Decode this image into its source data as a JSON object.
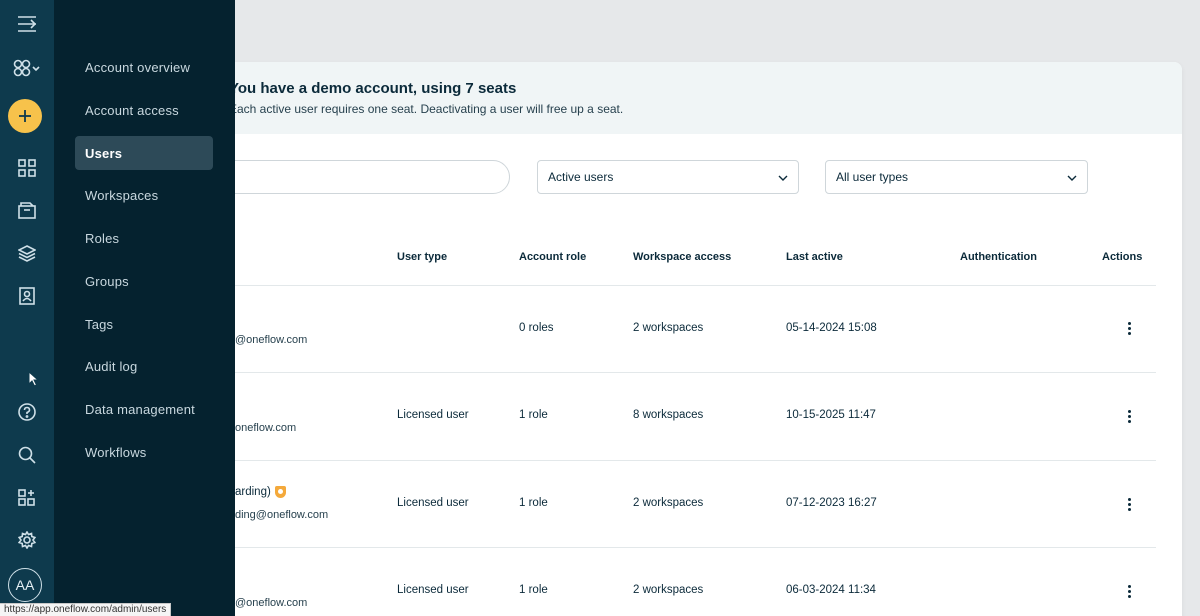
{
  "drawer": {
    "items": [
      {
        "label": "Account overview"
      },
      {
        "label": "Account access"
      },
      {
        "label": "Users"
      },
      {
        "label": "Workspaces"
      },
      {
        "label": "Roles"
      },
      {
        "label": "Groups"
      },
      {
        "label": "Tags"
      },
      {
        "label": "Audit log"
      },
      {
        "label": "Data management"
      },
      {
        "label": "Workflows"
      }
    ]
  },
  "rail": {
    "avatar_initials": "AA",
    "icons": [
      "menu-collapse-icon",
      "workspace-switcher-icon",
      "plus-icon",
      "dashboard-grid-icon",
      "documents-icon",
      "templates-layers-icon",
      "contacts-icon",
      "help-icon",
      "search-icon",
      "extensions-icon",
      "settings-icon"
    ]
  },
  "banner": {
    "title": "You have a demo account, using 7 seats",
    "subtitle": "Each active user requires one seat. Deactivating a user will free up a seat."
  },
  "filters": {
    "status_select": "Active users",
    "type_select": "All user types"
  },
  "table": {
    "headers": {
      "user_type": "User type",
      "account_role": "Account role",
      "workspace_access": "Workspace access",
      "last_active": "Last active",
      "authentication": "Authentication",
      "actions": "Actions"
    },
    "rows": [
      {
        "name": "",
        "email": "@oneflow.com",
        "user_type": "",
        "account_role": "0 roles",
        "workspace_access": "2 workspaces",
        "last_active": "05-14-2024 15:08"
      },
      {
        "name": "",
        "email": "oneflow.com",
        "user_type": "Licensed user",
        "account_role": "1 role",
        "workspace_access": "8 workspaces",
        "last_active": "10-15-2025 11:47"
      },
      {
        "name": "arding)",
        "email": "ding@oneflow.com",
        "user_type": "Licensed user",
        "account_role": "1 role",
        "workspace_access": "2 workspaces",
        "last_active": "07-12-2023 16:27"
      },
      {
        "name": "",
        "email": "@oneflow.com",
        "user_type": "Licensed user",
        "account_role": "1 role",
        "workspace_access": "2 workspaces",
        "last_active": "06-03-2024 11:34"
      }
    ]
  },
  "status_url": "https://app.oneflow.com/admin/users",
  "colors": {
    "rail_bg": "#0e3a4d",
    "drawer_bg": "#05222f",
    "accent_yellow": "#f7c24b",
    "active_nav_bg": "#2d4a58",
    "banner_bg": "#f0f5f6"
  }
}
